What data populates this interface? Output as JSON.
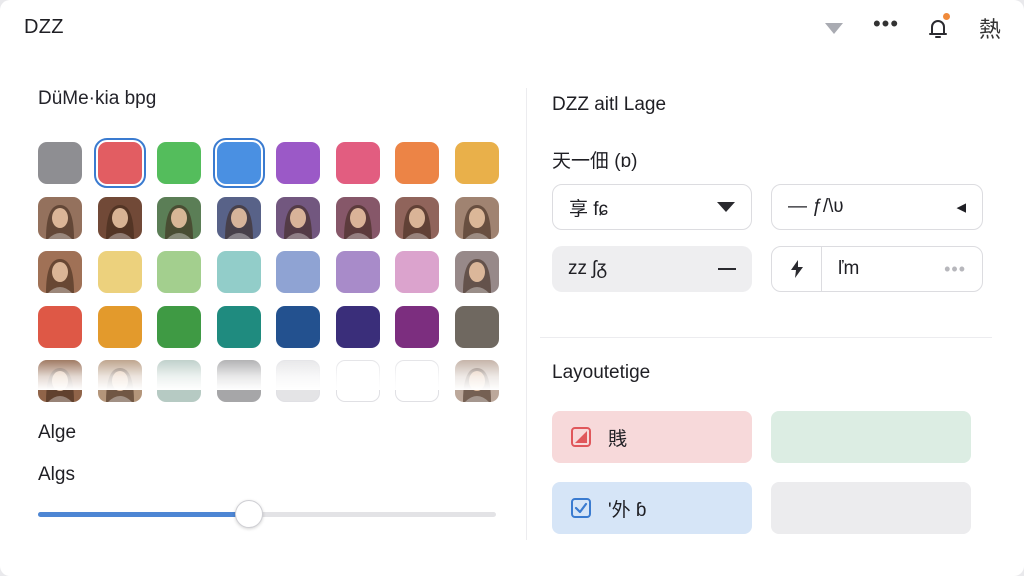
{
  "header": {
    "title": "DZZ",
    "icons": [
      "dropdown-triangle-icon",
      "more-dots-icon",
      "notification-icon",
      "language-icon"
    ],
    "more_label": "•••",
    "language_glyph": "熱",
    "notification_dot_color": "#f08a3a"
  },
  "left": {
    "title": "DüMe·kia bpg",
    "swatches": [
      {
        "kind": "color",
        "color": "#8e8e92"
      },
      {
        "kind": "color",
        "color": "#e25d62",
        "selected": true
      },
      {
        "kind": "color",
        "color": "#54bd5c"
      },
      {
        "kind": "color",
        "color": "#4a90e2",
        "selected": true
      },
      {
        "kind": "color",
        "color": "#9b59c7"
      },
      {
        "kind": "color",
        "color": "#e25d80"
      },
      {
        "kind": "color",
        "color": "#ec8446"
      },
      {
        "kind": "color",
        "color": "#e9b04a"
      },
      {
        "kind": "photo",
        "tint": "#b58a72"
      },
      {
        "kind": "photo",
        "tint": "#8a5a44"
      },
      {
        "kind": "photo",
        "tint": "#6f9a6a"
      },
      {
        "kind": "photo",
        "tint": "#6c78a6"
      },
      {
        "kind": "photo",
        "tint": "#8c6b9c"
      },
      {
        "kind": "photo",
        "tint": "#a46b80"
      },
      {
        "kind": "photo",
        "tint": "#b07b70"
      },
      {
        "kind": "photo",
        "tint": "#c4a08a"
      },
      {
        "kind": "photo",
        "tint": "#c48a6a"
      },
      {
        "kind": "color",
        "color": "#ecd17d"
      },
      {
        "kind": "color",
        "color": "#a3cf8e"
      },
      {
        "kind": "color",
        "color": "#92cdc9"
      },
      {
        "kind": "color",
        "color": "#8fa3d3"
      },
      {
        "kind": "color",
        "color": "#a88bc9"
      },
      {
        "kind": "color",
        "color": "#dba3cd"
      },
      {
        "kind": "photo",
        "tint": "#b9a8a8"
      },
      {
        "kind": "color",
        "color": "#de5846"
      },
      {
        "kind": "color",
        "color": "#e39a2c"
      },
      {
        "kind": "color",
        "color": "#3f9a44"
      },
      {
        "kind": "color",
        "color": "#1f8b7f"
      },
      {
        "kind": "color",
        "color": "#23518f"
      },
      {
        "kind": "color",
        "color": "#3a2e7a"
      },
      {
        "kind": "color",
        "color": "#7c2e7f"
      },
      {
        "kind": "color",
        "color": "#6f6860"
      },
      {
        "kind": "photo",
        "tint": "#b07a5a"
      },
      {
        "kind": "photo",
        "tint": "#dcb896"
      },
      {
        "kind": "color",
        "color": "#b6cac3"
      },
      {
        "kind": "color",
        "color": "#a6a6a8"
      },
      {
        "kind": "color",
        "color": "#e4e4e6"
      },
      {
        "kind": "color",
        "color": "#ffffff"
      },
      {
        "kind": "color",
        "color": "#ffffff"
      },
      {
        "kind": "photo",
        "tint": "#e6cdbd"
      }
    ],
    "label_a": "Alge",
    "label_b": "Algs",
    "slider_value": 0.46,
    "slider_fill_color": "#4d86d4"
  },
  "right": {
    "title": "DZZ aitl Lage",
    "subtitle": "天一佃 (ɒ)",
    "select_1": {
      "text": "享  fɕ",
      "icon": "caret-down-icon"
    },
    "select_2": {
      "text": "—  ƒ/\\ʋ",
      "end": "◂"
    },
    "field_3": {
      "text": "ᴢᴢ  ʃᵹ",
      "icon": "minus-icon"
    },
    "field_4": {
      "text": "ľm",
      "end": "•••",
      "icon": "bolt-icon"
    },
    "section_title": "Layoutetige",
    "cards": [
      {
        "label": "賎",
        "bg": "#f7d9da",
        "icon": "checkbox-red-icon"
      },
      {
        "label": "",
        "bg": "#dcede3",
        "icon": ""
      },
      {
        "label": "'外 ɓ",
        "bg": "#d6e5f7",
        "icon": "checkbox-blue-icon"
      },
      {
        "label": "",
        "bg": "#ececee",
        "icon": ""
      }
    ]
  }
}
